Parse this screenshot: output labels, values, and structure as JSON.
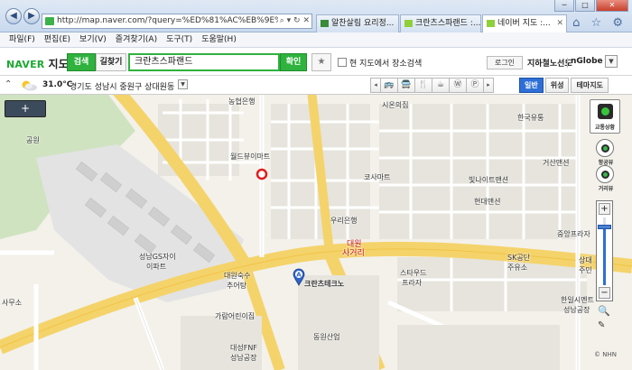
{
  "browser": {
    "url": "http://map.naver.com/?query=%ED%81%AC%EB%9E%80",
    "url_icons": "⌕ ▾ ↻ ✕",
    "tabs": [
      {
        "label": "알찬살림 요리정..."
      },
      {
        "label": "크란츠스파랜드 :..."
      },
      {
        "label": "네이버 지도 :..."
      }
    ],
    "window_buttons": [
      "─",
      "□",
      "✕"
    ],
    "toolbar_icons": "⌂ ☆ ⚙"
  },
  "menu": [
    "파일(F)",
    "편집(E)",
    "보기(V)",
    "즐겨찾기(A)",
    "도구(T)",
    "도움말(H)"
  ],
  "naver": {
    "logo_brand": "NAVER",
    "logo_service": "지도",
    "search_button": "검색",
    "route_button": "길찾기",
    "query": "크란츠스파랜드",
    "confirm_button": "확인",
    "favorite_icon": "★",
    "checkbox_label": "현 지도에서 장소검색",
    "login_button": "로그인",
    "subway_link": "지하철노선도",
    "nglobe_link": "nGlobe",
    "dropdown_icon": "▼"
  },
  "toolbar": {
    "collapse_icon": "⌃",
    "temperature": "31.0°C",
    "location": "경기도 성남시 중원구 상대원동",
    "poi_icons": [
      "◂",
      "🚌",
      "🚍",
      "🍴",
      "☕",
      "Ⓦ",
      "Ⓟ",
      "▸"
    ],
    "map_types": [
      {
        "label": "일반",
        "active": true
      },
      {
        "label": "위성",
        "active": false
      },
      {
        "label": "테마지도",
        "active": false
      }
    ]
  },
  "map": {
    "minimap_button": "+",
    "controls": {
      "traffic": "교통상황",
      "fixed": "항공뷰",
      "distance": "거리뷰",
      "zoom_in": "+",
      "zoom_out": "−",
      "zoom_level": 0.85,
      "magnify_icon": "🔍",
      "ruler_icon": "✎",
      "copyright": "© NHN"
    },
    "marker_letter": "A",
    "labels": [
      {
        "text": "공원",
        "cls": ""
      },
      {
        "text": "농협은행",
        "cls": ""
      },
      {
        "text": "월드뷰이마트",
        "cls": ""
      },
      {
        "text": "시온의집",
        "cls": ""
      },
      {
        "text": "한국유통",
        "cls": ""
      },
      {
        "text": "거산맨션",
        "cls": ""
      },
      {
        "text": "코사마트",
        "cls": ""
      },
      {
        "text": "빛나이트맨션",
        "cls": ""
      },
      {
        "text": "현대맨션",
        "cls": ""
      },
      {
        "text": "우리은행",
        "cls": ""
      },
      {
        "text": "중앙프라자",
        "cls": ""
      },
      {
        "text": "대원",
        "cls": "red"
      },
      {
        "text": "사거리",
        "cls": "red"
      },
      {
        "text": "SK공단",
        "cls": ""
      },
      {
        "text": "주유소",
        "cls": ""
      },
      {
        "text": "상대",
        "cls": ""
      },
      {
        "text": "주민",
        "cls": ""
      },
      {
        "text": "스타우드",
        "cls": ""
      },
      {
        "text": "프라자",
        "cls": ""
      },
      {
        "text": "크란츠테크노",
        "cls": "bold"
      },
      {
        "text": "한일시멘트",
        "cls": ""
      },
      {
        "text": "성남공장",
        "cls": ""
      },
      {
        "text": "성남GS자이",
        "cls": ""
      },
      {
        "text": "이파트",
        "cls": ""
      },
      {
        "text": "대원숙수",
        "cls": ""
      },
      {
        "text": "추어탕",
        "cls": ""
      },
      {
        "text": "가람어린이집",
        "cls": ""
      },
      {
        "text": "동원산업",
        "cls": ""
      },
      {
        "text": "대성FNF",
        "cls": ""
      },
      {
        "text": "성남공장",
        "cls": ""
      },
      {
        "text": "사무소",
        "cls": ""
      }
    ]
  }
}
